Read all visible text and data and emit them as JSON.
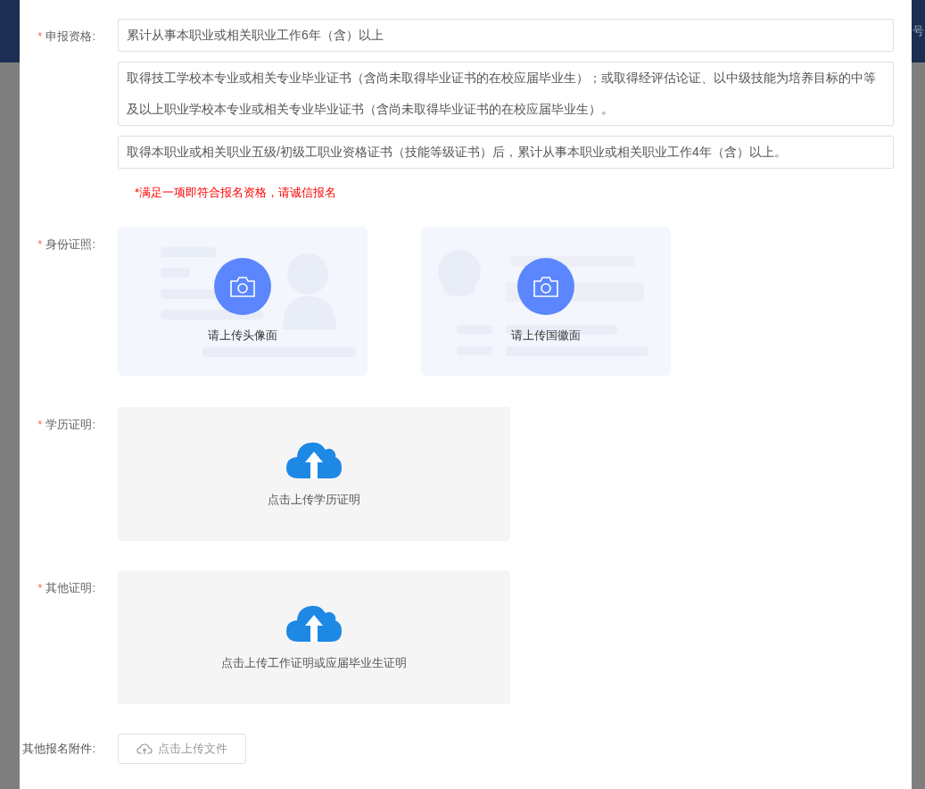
{
  "background_header": {
    "text": "号"
  },
  "qualification": {
    "mark": "*",
    "label": "申报资格:",
    "options": [
      "累计从事本职业或相关职业工作6年（含）以上",
      "取得技工学校本专业或相关专业毕业证书（含尚未取得毕业证书的在校应届毕业生）；或取得经评估论证、以中级技能为培养目标的中等及以上职业学校本专业或相关专业毕业证书（含尚未取得毕业证书的在校应届毕业生）。",
      "取得本职业或相关职业五级/初级工职业资格证书（技能等级证书）后，累计从事本职业或相关职业工作4年（含）以上。"
    ],
    "note": "*满足一项即符合报名资格，请诚信报名"
  },
  "id_card": {
    "mark": "*",
    "label": "身份证照:",
    "uploads": [
      {
        "kind": "front",
        "text": "请上传头像面"
      },
      {
        "kind": "back",
        "text": "请上传国徽面"
      }
    ]
  },
  "education": {
    "mark": "*",
    "label": "学历证明:",
    "upload_text": "点击上传学历证明"
  },
  "other_proof": {
    "mark": "*",
    "label": "其他证明:",
    "upload_text": "点击上传工作证明或应届毕业生证明"
  },
  "attachments": {
    "label": "其他报名附件:",
    "button": "点击上传文件"
  }
}
